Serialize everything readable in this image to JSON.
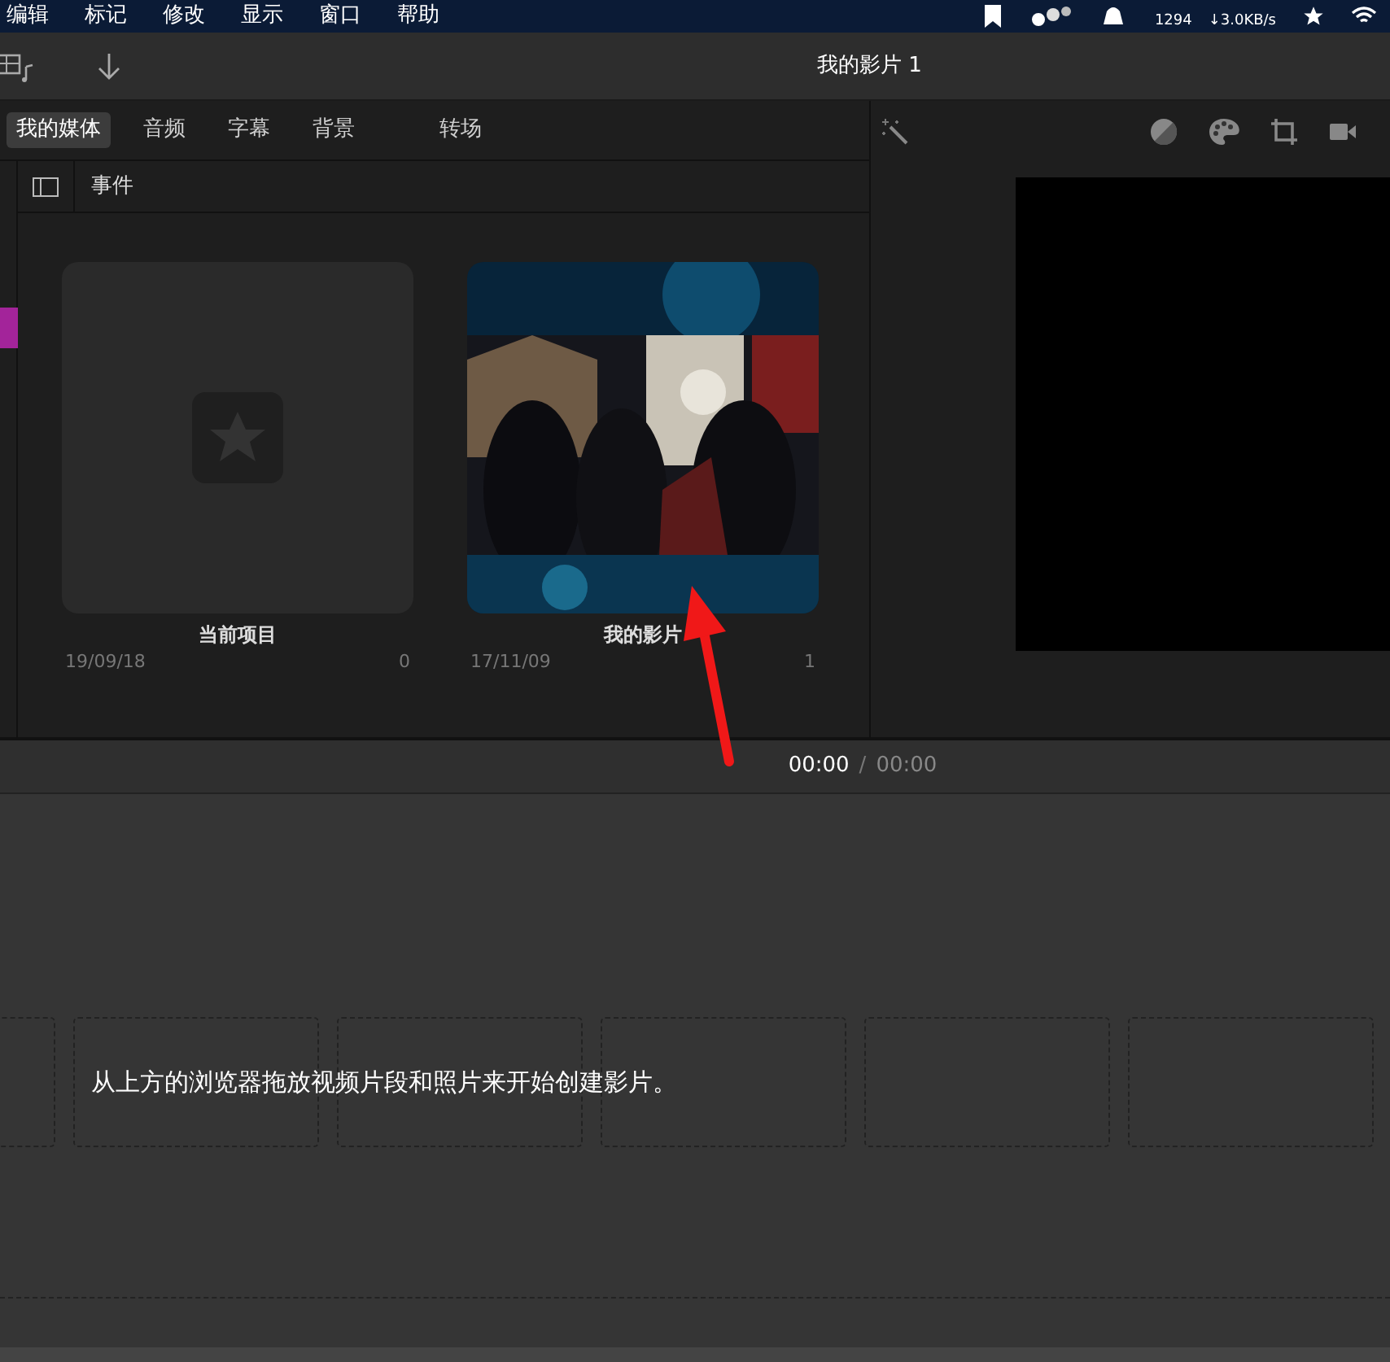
{
  "menu_bar": {
    "items": [
      "编辑",
      "标记",
      "修改",
      "显示",
      "窗口",
      "帮助"
    ],
    "status": {
      "line_1": "1294",
      "line_2": "↓3.0KB/s"
    }
  },
  "toolbar": {
    "title": "我的影片 1"
  },
  "tabs": [
    {
      "label": "我的媒体",
      "selected": true
    },
    {
      "label": "音频",
      "selected": false
    },
    {
      "label": "字幕",
      "selected": false
    },
    {
      "label": "背景",
      "selected": false
    },
    {
      "label": "转场",
      "selected": false
    }
  ],
  "browser": {
    "header": "事件",
    "projects": [
      {
        "kind": "empty",
        "name": "当前项目",
        "date": "19/09/18",
        "count": "0"
      },
      {
        "kind": "picture",
        "name": "我的影片",
        "date": "17/11/09",
        "count": "1"
      }
    ]
  },
  "timeline": {
    "current_time": "00:00",
    "separator": "/",
    "total_time": "00:00",
    "hint": "从上方的浏览器拖放视频片段和照片来开始创建影片。"
  }
}
